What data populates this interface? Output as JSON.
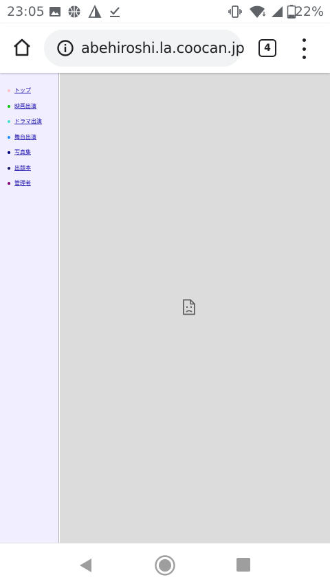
{
  "status_bar": {
    "time": "23:05",
    "left_icons": [
      "image-icon",
      "basketball-icon",
      "signal-notification-icon",
      "download-done-icon"
    ],
    "right_icons": [
      "vibrate-icon",
      "wifi-icon",
      "cellular-signal-icon",
      "battery-icon"
    ],
    "battery_percent": "22%"
  },
  "toolbar": {
    "url": "abehiroshi.la.coocan.jp",
    "tab_count": "4"
  },
  "sidebar": {
    "items": [
      {
        "label": "トップ",
        "bullet_color": "#ffc0cb"
      },
      {
        "label": "映画出演",
        "bullet_color": "#00cc00"
      },
      {
        "label": "ドラマ出演",
        "bullet_color": "#40e0d0"
      },
      {
        "label": "舞台出演",
        "bullet_color": "#1e90ff"
      },
      {
        "label": "写真集",
        "bullet_color": "#000080"
      },
      {
        "label": "出版本",
        "bullet_color": "#191970"
      },
      {
        "label": "管理者",
        "bullet_color": "#800080"
      }
    ]
  },
  "main_frame": {
    "state": "broken-page-icon"
  },
  "colors": {
    "sidebar_bg": "#f0eeff",
    "frame_bg": "#dcdcdc",
    "link": "#1a0dab"
  }
}
